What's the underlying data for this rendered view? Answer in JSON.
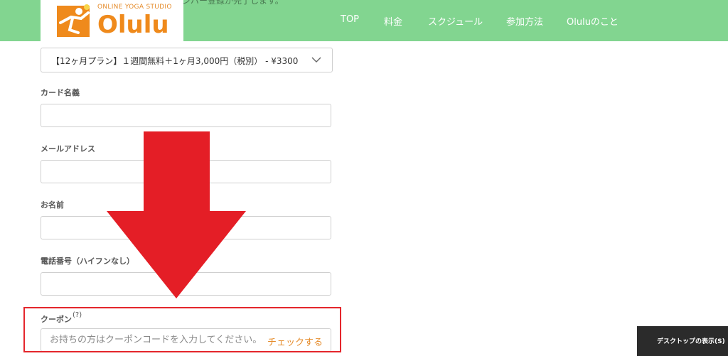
{
  "header": {
    "overlap_text": "ンバー登録が完了します。",
    "nav": [
      "TOP",
      "料金",
      "スクジュール",
      "参加方法",
      "Oluluのこと"
    ]
  },
  "logo": {
    "tagline": "ONLINE YOGA STUDIO",
    "wordmark": "Olulu"
  },
  "form": {
    "plan_select": {
      "value": "【12ヶ月プラン】１週間無料＋1ヶ月3,000円（税別） - ¥3300"
    },
    "card_name": {
      "label": "カード名義",
      "value": ""
    },
    "email": {
      "label": "メールアドレス",
      "value": ""
    },
    "name": {
      "label": "お名前",
      "value": ""
    },
    "phone": {
      "label": "電話番号（ハイフンなし）",
      "value": ""
    },
    "coupon": {
      "label": "クーポン",
      "help_symbol": "?",
      "placeholder": "お持ちの方はクーポンコードを入力してください。",
      "check_label": "チェックする"
    }
  },
  "annotation": {
    "arrow_color": "#e41e26",
    "frame_color": "#e4262c"
  },
  "colors": {
    "header": "#82d590",
    "accent": "#e58b2a"
  },
  "tooltip": {
    "text": "デスクトップの表示(S)"
  }
}
